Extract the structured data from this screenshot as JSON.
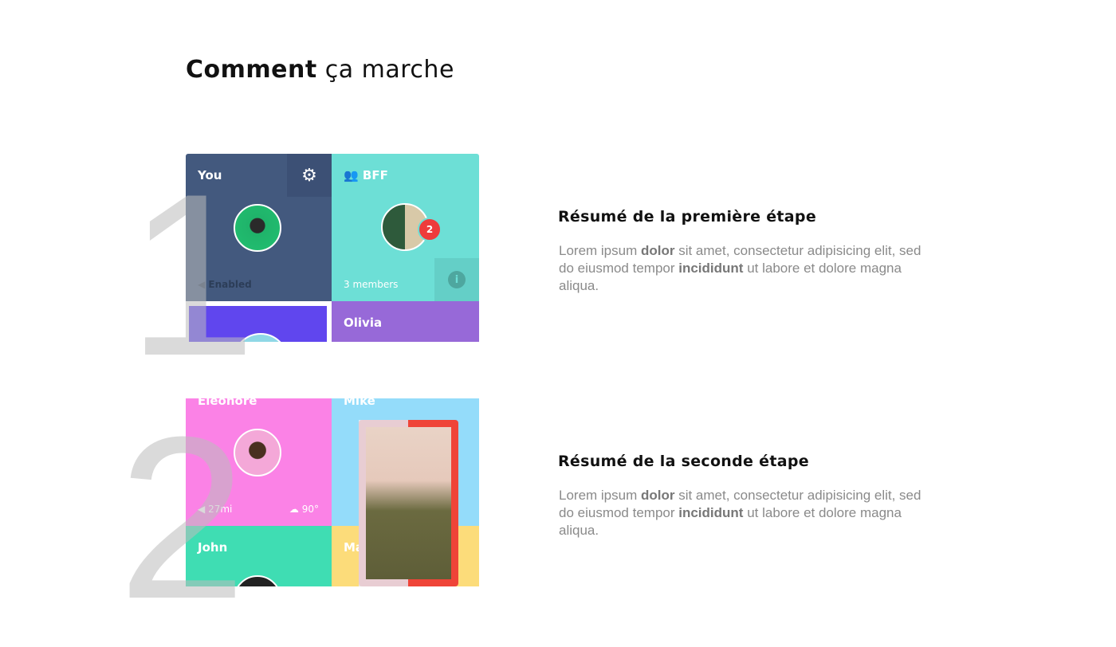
{
  "title": {
    "bold": "Comment",
    "rest": " ça marche"
  },
  "steps": [
    {
      "number": "1",
      "heading": "Résumé de la première étape",
      "text": {
        "a": "Lorem ipsum ",
        "b": "dolor",
        "c": " sit amet, consectetur adipisicing elit, sed do eiusmod tempor ",
        "d": "incididunt",
        "e": " ut labore et dolore magna aliqua."
      }
    },
    {
      "number": "2",
      "heading": "Résumé de la seconde étape",
      "text": {
        "a": "Lorem ipsum ",
        "b": "dolor",
        "c": " sit amet, consectetur adipisicing elit, sed do eiusmod tempor ",
        "d": "incididunt",
        "e": " ut labore et dolore magna aliqua."
      }
    }
  ],
  "shot1": {
    "you": "You",
    "enabled": "Enabled",
    "bff": "BFF",
    "badge": "2",
    "members": "3 members",
    "olivia": "Olivia"
  },
  "shot2": {
    "eleonore": "Eleonore",
    "distance": "27mi",
    "temp": "90°",
    "mike": "Mike",
    "john": "John",
    "ma": "Ma"
  }
}
